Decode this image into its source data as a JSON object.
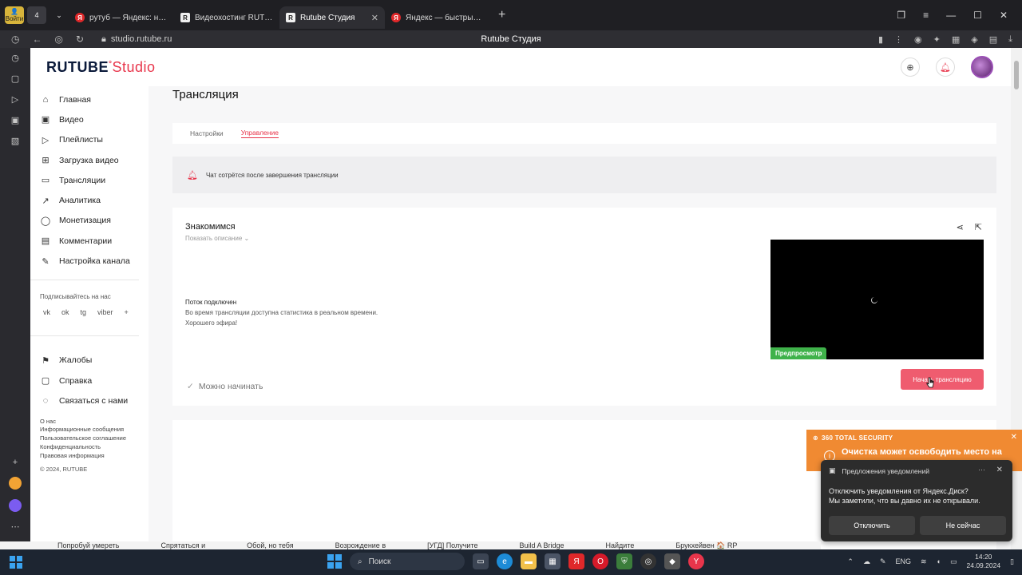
{
  "browser": {
    "login_badge": "Войти",
    "tabs": [
      {
        "title": "рутуб — Яндекс: нашлось",
        "fav": "Я"
      },
      {
        "title": "Видеохостинг RUTUBE. С",
        "fav": "R"
      },
      {
        "title": "Rutube Студия",
        "fav": "R",
        "active": true
      },
      {
        "title": "Яндекс — быстрый поиск",
        "fav": "Я"
      }
    ],
    "url": "studio.rutube.ru",
    "page_title": "Rutube Студия"
  },
  "header": {
    "logo_main": "RUTUBE",
    "logo_studio": "Studio"
  },
  "sidebar": {
    "items": [
      {
        "label": "Главная",
        "icon": "home-icon",
        "glyph": "⌂"
      },
      {
        "label": "Видео",
        "icon": "video-icon",
        "glyph": "▣"
      },
      {
        "label": "Плейлисты",
        "icon": "playlist-icon",
        "glyph": "▷"
      },
      {
        "label": "Загрузка видео",
        "icon": "upload-icon",
        "glyph": "⊞"
      },
      {
        "label": "Трансляции",
        "icon": "broadcast-icon",
        "glyph": "▭"
      },
      {
        "label": "Аналитика",
        "icon": "analytics-icon",
        "glyph": "↗"
      },
      {
        "label": "Монетизация",
        "icon": "money-icon",
        "glyph": "◯"
      },
      {
        "label": "Комментарии",
        "icon": "comments-icon",
        "glyph": "▤"
      },
      {
        "label": "Настройка канала",
        "icon": "wrench-icon",
        "glyph": "✎"
      }
    ],
    "subscribe_label": "Подписывайтесь на нас",
    "socials": [
      "vk",
      "ok",
      "tg",
      "viber",
      "+"
    ],
    "support": [
      {
        "label": "Жалобы",
        "icon": "flag-icon",
        "glyph": "⚑"
      },
      {
        "label": "Справка",
        "icon": "help-icon",
        "glyph": "▢"
      },
      {
        "label": "Связаться с нами",
        "icon": "chat-icon",
        "glyph": "◌"
      }
    ],
    "footer_links": [
      "О нас",
      "Информационные сообщения",
      "Пользовательское соглашение",
      "Конфиденциальность",
      "Правовая информация"
    ],
    "copyright": "© 2024, RUTUBE"
  },
  "main": {
    "title": "Трансляция",
    "tabs": [
      {
        "label": "Настройки"
      },
      {
        "label": "Управление",
        "active": true
      }
    ],
    "notice": "Чат сотрётся после завершения трансляции",
    "stream": {
      "title": "Знакомимся",
      "show_description": "Показать описание",
      "status_title": "Поток подключен",
      "status_line1": "Во время трансляции доступна статистика в реальном времени.",
      "status_line2": "Хорошего эфира!",
      "preview_badge": "Предпросмотр",
      "ready_label": "Можно начинать",
      "start_button": "Начать трансляцию"
    }
  },
  "antivirus": {
    "brand": "360 TOTAL SECURITY",
    "message": "Очистка может освободить место на"
  },
  "toast": {
    "title": "Предложения уведомлений",
    "line1": "Отключить уведомления от Яндекс.Диск?",
    "line2": "Мы заметили, что вы давно их не открывали.",
    "btn_disable": "Отключить",
    "btn_later": "Не сейчас"
  },
  "ticker": [
    "Попробуй умереть",
    "Спрятаться и",
    "Обой, но тебя",
    "Возрождение в",
    "[УГД] Получите",
    "Build A Bridge",
    "Найдите",
    "Брукхейвен 🏠 RP"
  ],
  "taskbar": {
    "search_placeholder": "Поиск",
    "lang": "ENG",
    "time": "14:20",
    "date": "24.09.2024"
  },
  "colors": {
    "accent": "#e8354b",
    "start_button": "#ef5c6f",
    "preview_badge": "#3fb24a",
    "antivirus": "#f08a32"
  }
}
